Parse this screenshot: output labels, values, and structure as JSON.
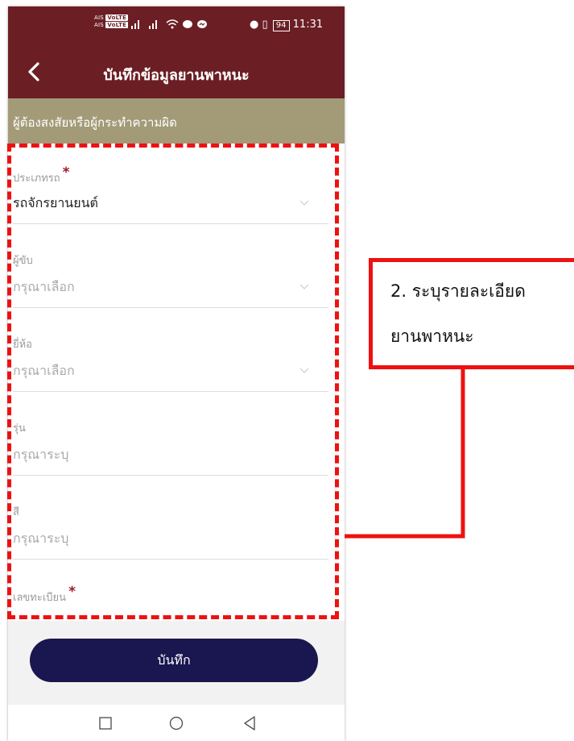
{
  "status_bar": {
    "sim1": "AIS",
    "sim2": "AIS",
    "volte": "VoLTE",
    "battery": "94",
    "time": "11:31"
  },
  "app_bar": {
    "title": "บันทึกข้อมูลยานพาหนะ",
    "back_icon": "chevron-left-icon"
  },
  "section": {
    "header": "ผู้ต้องสงสัยหรือผู้กระทำความผิด"
  },
  "form": {
    "vehicle_type": {
      "label": "ประเภทรถ",
      "required_mark": "*",
      "value": "รถจักรยานยนต์"
    },
    "driver": {
      "label": "ผู้ขับ",
      "placeholder": "กรุณาเลือก"
    },
    "brand": {
      "label": "ยี่ห้อ",
      "placeholder": "กรุณาเลือก"
    },
    "model": {
      "label": "รุ่น",
      "placeholder": "กรุณาระบุ"
    },
    "color": {
      "label": "สี",
      "placeholder": "กรุณาระบุ"
    },
    "plate": {
      "label": "เลขทะเบียน",
      "required_mark": "*"
    }
  },
  "actions": {
    "save_label": "บันทึก"
  },
  "nav": {
    "icons": [
      "square-icon",
      "circle-icon",
      "triangle-back-icon"
    ]
  },
  "annotation": {
    "line1": "2. ระบุรายละเอียด",
    "line2": "ยานพาหนะ"
  },
  "colors": {
    "header_bg": "#6b1f24",
    "section_bg": "#a39a78",
    "button_bg": "#1a1650",
    "required": "#9b1b2a",
    "annotation": "#ee1111"
  }
}
